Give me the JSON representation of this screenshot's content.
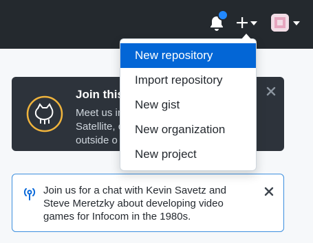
{
  "header": {
    "notification_icon": "bell-icon",
    "create_icon": "plus-icon",
    "avatar_icon": "user-avatar"
  },
  "create_menu": {
    "items": [
      {
        "label": "New repository",
        "active": true
      },
      {
        "label": "Import repository",
        "active": false
      },
      {
        "label": "New gist",
        "active": false
      },
      {
        "label": "New organization",
        "active": false
      },
      {
        "label": "New project",
        "active": false
      }
    ]
  },
  "dark_banner": {
    "title": "Join this",
    "body_lines": [
      "Meet us in",
      "Satellite, c",
      "outside o"
    ]
  },
  "light_banner": {
    "message": "Join us for a chat with Kevin Savetz and Steve Meretzky about developing video games for Infocom in the 1980s."
  },
  "colors": {
    "header_bg": "#24292e",
    "accent": "#0366d6",
    "notification_dot": "#2188ff",
    "dark_banner_bg": "#2d333b",
    "octocat_ring": "#f0b43c"
  }
}
